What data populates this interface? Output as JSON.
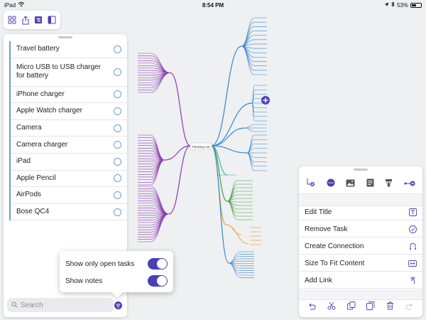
{
  "status_bar": {
    "device": "iPad",
    "time": "8:54 PM",
    "battery": "53%",
    "battery_level": 0.53
  },
  "accent_color": "#4b3fb8",
  "toolbar": {
    "icons": [
      "grid-icon",
      "share-icon",
      "outline-icon",
      "sidebar-icon"
    ]
  },
  "mindmap": {
    "root_label": "Packing List"
  },
  "tasks": {
    "items": [
      {
        "label": "Travel battery"
      },
      {
        "label": "Micro USB to USB charger for battery"
      },
      {
        "label": "iPhone charger"
      },
      {
        "label": "Apple Watch charger"
      },
      {
        "label": "Camera"
      },
      {
        "label": "Camera charger"
      },
      {
        "label": "iPad"
      },
      {
        "label": "Apple Pencil"
      },
      {
        "label": "AirPods"
      },
      {
        "label": "Bose QC4"
      }
    ]
  },
  "search": {
    "placeholder": "Search"
  },
  "filter_popover": {
    "open_tasks_label": "Show only open tasks",
    "open_tasks_on": true,
    "show_notes_label": "Show notes",
    "show_notes_on": true
  },
  "inspector": {
    "top_icons": [
      "add-child-icon",
      "more-icon",
      "image-icon",
      "notes-icon",
      "tag-icon",
      "connect-icon"
    ],
    "actions": [
      {
        "label": "Edit Title",
        "icon": "text-cursor-icon"
      },
      {
        "label": "Remove Task",
        "icon": "checkmark-circle-icon"
      },
      {
        "label": "Create Connection",
        "icon": "connection-icon"
      },
      {
        "label": "Size To Fit Content",
        "icon": "fit-content-icon"
      },
      {
        "label": "Add Link",
        "icon": "link-icon"
      }
    ],
    "bottom_icons": [
      "undo-icon",
      "cut-icon",
      "copy-icon",
      "duplicate-icon",
      "trash-icon",
      "redo-icon"
    ]
  }
}
